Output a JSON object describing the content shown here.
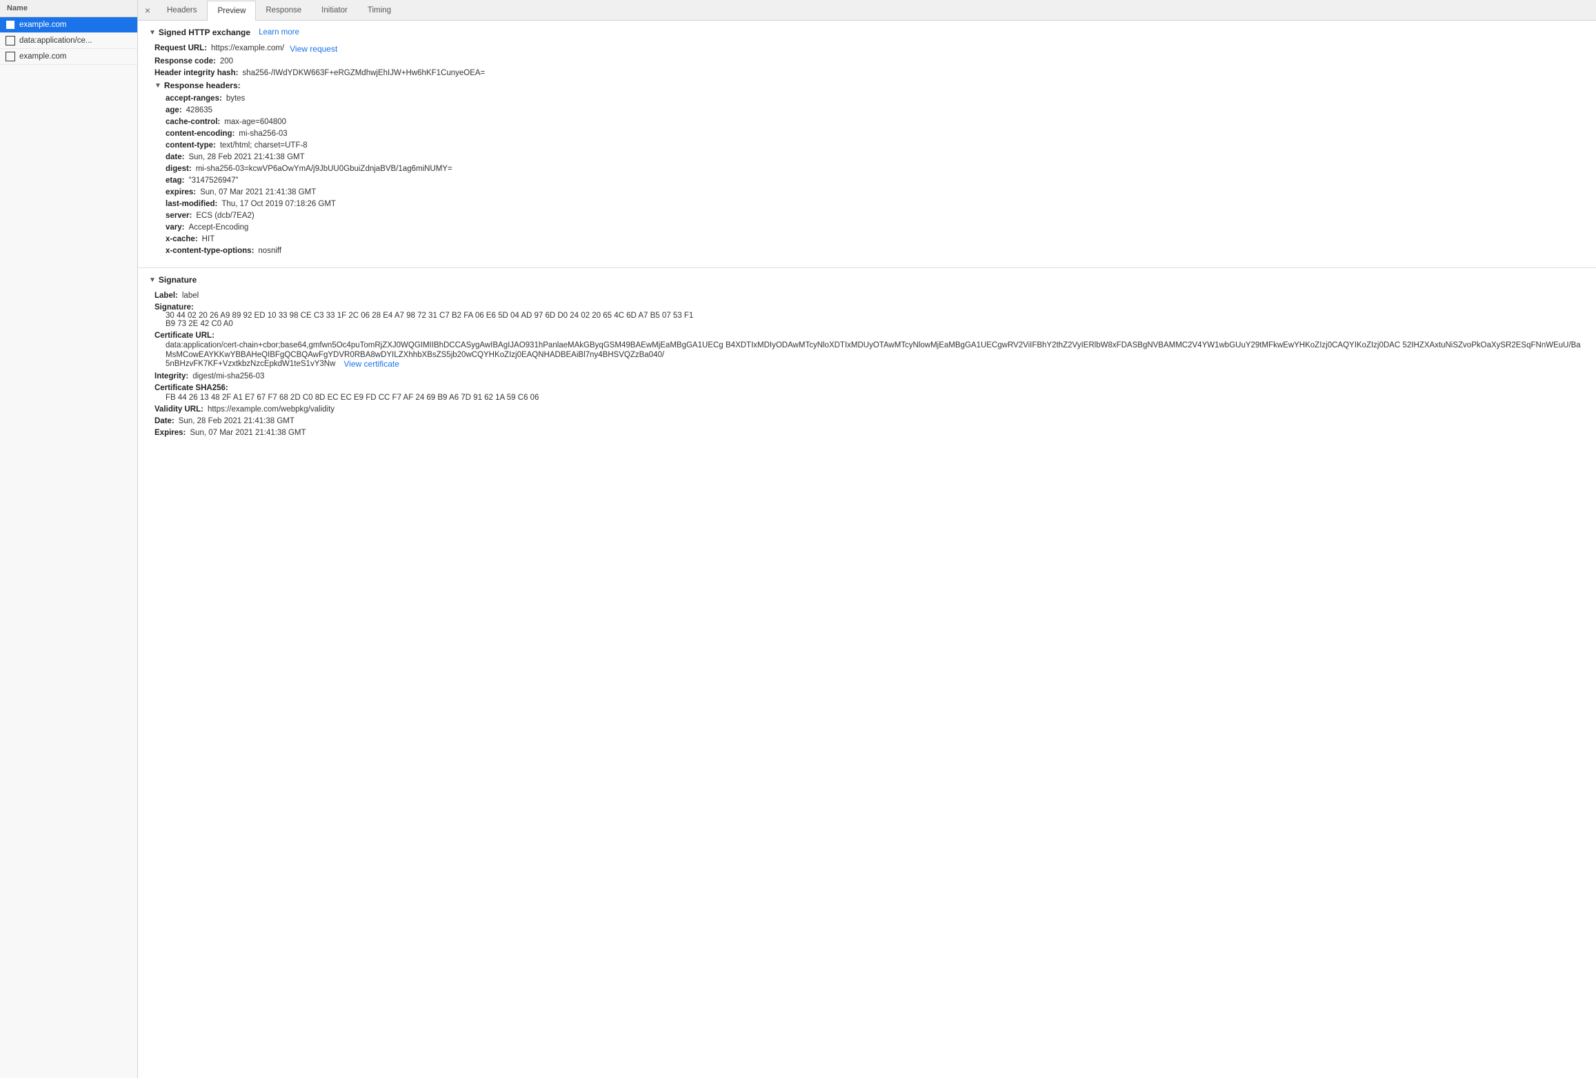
{
  "sidebar": {
    "header": "Name",
    "items": [
      {
        "id": "item-example-com",
        "label": "example.com",
        "active": true
      },
      {
        "id": "item-data-application",
        "label": "data:application/ce...",
        "active": false
      },
      {
        "id": "item-example-com-2",
        "label": "example.com",
        "active": false
      }
    ]
  },
  "tabs": {
    "close_symbol": "×",
    "items": [
      {
        "id": "tab-headers",
        "label": "Headers",
        "active": false
      },
      {
        "id": "tab-preview",
        "label": "Preview",
        "active": true
      },
      {
        "id": "tab-response",
        "label": "Response",
        "active": false
      },
      {
        "id": "tab-initiator",
        "label": "Initiator",
        "active": false
      },
      {
        "id": "tab-timing",
        "label": "Timing",
        "active": false
      }
    ]
  },
  "signed_http_exchange": {
    "section_label": "Signed HTTP exchange",
    "learn_more": "Learn more",
    "request_url_label": "Request URL:",
    "request_url_value": "https://example.com/",
    "view_request": "View request",
    "response_code_label": "Response code:",
    "response_code_value": "200",
    "header_integrity_label": "Header integrity hash:",
    "header_integrity_value": "sha256-/IWdYDKW663F+eRGZMdhwjEhIJW+Hw6hKF1CunyeOEA=",
    "response_headers": {
      "label": "Response headers:",
      "headers": [
        {
          "name": "accept-ranges",
          "value": "bytes"
        },
        {
          "name": "age",
          "value": "428635"
        },
        {
          "name": "cache-control",
          "value": "max-age=604800"
        },
        {
          "name": "content-encoding",
          "value": "mi-sha256-03"
        },
        {
          "name": "content-type",
          "value": "text/html; charset=UTF-8"
        },
        {
          "name": "date",
          "value": "Sun, 28 Feb 2021 21:41:38 GMT"
        },
        {
          "name": "digest",
          "value": "mi-sha256-03=kcwVP6aOwYmA/j9JbUU0GbuiZdnjaBVB/1ag6miNUMY="
        },
        {
          "name": "etag",
          "value": "\"3147526947\""
        },
        {
          "name": "expires",
          "value": "Sun, 07 Mar 2021 21:41:38 GMT"
        },
        {
          "name": "last-modified",
          "value": "Thu, 17 Oct 2019 07:18:26 GMT"
        },
        {
          "name": "server",
          "value": "ECS (dcb/7EA2)"
        },
        {
          "name": "vary",
          "value": "Accept-Encoding"
        },
        {
          "name": "x-cache",
          "value": "HIT"
        },
        {
          "name": "x-content-type-options",
          "value": "nosniff"
        }
      ]
    }
  },
  "signature": {
    "section_label": "Signature",
    "label_field": "Label:",
    "label_value": "label",
    "signature_field": "Signature:",
    "signature_line1": "30 44 02 20 26 A9 89 92 ED 10 33 98 CE C3 33 1F 2C 06 28 E4 A7 98 72 31 C7 B2 FA 06 E6 5D 04 AD 97 6D D0 24 02 20 65 4C 6D A7 B5 07 53 F1",
    "signature_line2": "B9 73 2E 42 C0 A0",
    "cert_url_label": "Certificate URL:",
    "cert_url_value": "data:application/cert-chain+cbor;base64,gmfwn5Oc4puTomRjZXJ0WQGIMIIBhDCCASygAwIBAgIJAO931hPanlaeMAkGByqGSM49BAEwMjEaMBgGA1UECg",
    "cert_url_line2": "B4XDTIxMDIyODAwMTcyNloXDTIxMDUyOTAwMTcyNlowMjEaMBgGA1UECgwRV2ViIFBhY2thZ2VyIERlbW8xFDASBgNVBAMMC2V4YW1wbGUuY29tMFkwEwYHKoZIzj0CAQYIKoZIzj0DAC",
    "cert_url_line3": "52IHZXAxtuNiSZvoPkOaXySR2ESqFNnWEuU/BaMsMCowEAYKKwYBBAHeQIBFgQCBQAwFgYDVR0RBA8wDYILZXhhbXBsZS5jb20wCQYHKoZIzj0EAQNHADBEAiBl7ny4BHSVQZzBa040/",
    "cert_url_line4": "5nBHzvFK7KF+VzxtkbzNzcEpkdW1teS1vY3Nw",
    "view_certificate": "View certificate",
    "integrity_label": "Integrity:",
    "integrity_value": "digest/mi-sha256-03",
    "cert_sha256_label": "Certificate SHA256:",
    "cert_sha256_value": "FB 44 26 13 48 2F A1 E7 67 F7 68 2D C0 8D EC EC E9 FD CC F7 AF 24 69 B9 A6 7D 91 62 1A 59 C6 06",
    "validity_url_label": "Validity URL:",
    "validity_url_value": "https://example.com/webpkg/validity",
    "date_label": "Date:",
    "date_value": "Sun, 28 Feb 2021 21:41:38 GMT",
    "expires_label": "Expires:",
    "expires_value": "Sun, 07 Mar 2021 21:41:38 GMT"
  }
}
